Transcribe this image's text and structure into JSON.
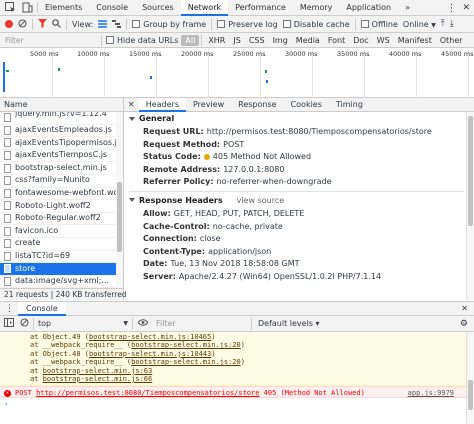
{
  "tabbar": {
    "tabs": [
      "Elements",
      "Console",
      "Sources",
      "Network",
      "Performance",
      "Memory",
      "Application"
    ],
    "active": "Network",
    "more_label": "»"
  },
  "toolbar": {
    "view_label": "View:",
    "group_by_frame": "Group by frame",
    "preserve_log": "Preserve log",
    "disable_cache": "Disable cache",
    "offline": "Offline",
    "throttle": "Online"
  },
  "filterbar": {
    "placeholder": "Filter",
    "hide_data_urls": "Hide data URLs",
    "types": [
      "All",
      "XHR",
      "JS",
      "CSS",
      "Img",
      "Media",
      "Font",
      "Doc",
      "WS",
      "Manifest",
      "Other"
    ],
    "active_type": "All"
  },
  "overview": {
    "ticks": [
      "5000 ms",
      "10000 ms",
      "15000 ms",
      "20000 ms",
      "25000 ms",
      "30000 ms",
      "35000 ms",
      "40000 ms",
      "45000 ms"
    ]
  },
  "requests": {
    "column_name": "Name",
    "items": [
      "jquery.min.js?v=1.12.4",
      "ajaxEventsEmpleados.js",
      "ajaxEventsTipopermisos.js",
      "ajaxEventsTiemposC.js",
      "bootstrap-select.min.js",
      "css?family=Nunito",
      "fontawesome-webfont.woff2?",
      "Roboto-Light.woff2",
      "Roboto-Regular.woff2",
      "favicon.ico",
      "create",
      "listaTC?id=69",
      "store",
      "data:image/svg+xml;..."
    ],
    "selected": "store",
    "summary": "21 requests | 240 KB transferred"
  },
  "details": {
    "tabs": [
      "Headers",
      "Preview",
      "Response",
      "Cookies",
      "Timing"
    ],
    "active_tab": "Headers",
    "general": {
      "title": "General",
      "request_url_key": "Request URL:",
      "request_url": "http://permisos.test:8080/Tiemposcompensatorios/store",
      "request_method_key": "Request Method:",
      "request_method": "POST",
      "status_code_key": "Status Code:",
      "status_code": "405 Method Not Allowed",
      "remote_address_key": "Remote Address:",
      "remote_address": "127.0.0.1:8080",
      "referrer_policy_key": "Referrer Policy:",
      "referrer_policy": "no-referrer-when-downgrade"
    },
    "response_headers": {
      "title": "Response Headers",
      "view_source": "view source",
      "rows": [
        {
          "k": "Allow:",
          "v": "GET, HEAD, PUT, PATCH, DELETE"
        },
        {
          "k": "Cache-Control:",
          "v": "no-cache, private"
        },
        {
          "k": "Connection:",
          "v": "close"
        },
        {
          "k": "Content-Type:",
          "v": "application/json"
        },
        {
          "k": "Date:",
          "v": "Tue, 13 Nov 2018 18:58:08 GMT"
        },
        {
          "k": "Server:",
          "v": "Apache/2.4.27 (Win64) OpenSSL/1.0.2l PHP/7.1.14"
        }
      ]
    }
  },
  "drawer": {
    "tab": "Console",
    "context": "top",
    "filter_placeholder": "Filter",
    "levels": "Default levels ▾"
  },
  "console": {
    "warn_lines": [
      {
        "pre": "at Object.49 (",
        "link": "bootstrap-select.min.js:10465",
        "post": ")"
      },
      {
        "pre": "at __webpack_require__ (",
        "link": "bootstrap-select.min.js:20",
        "post": ")"
      },
      {
        "pre": "at Object.48 (",
        "link": "bootstrap-select.min.js:10443",
        "post": ")"
      },
      {
        "pre": "at __webpack_require__ (",
        "link": "bootstrap-select.min.js:20",
        "post": ")"
      },
      {
        "pre": "at ",
        "link": "bootstrap-select.min.js:63",
        "post": ""
      },
      {
        "pre": "at ",
        "link": "bootstrap-select.min.js:66",
        "post": ""
      }
    ],
    "error": {
      "method": "POST",
      "url": "http://permisos.test:8080/Tiemposcompensatorios/store",
      "status": "405 (Method Not Allowed)",
      "source": "app.js:9979"
    },
    "prompt": "›"
  }
}
